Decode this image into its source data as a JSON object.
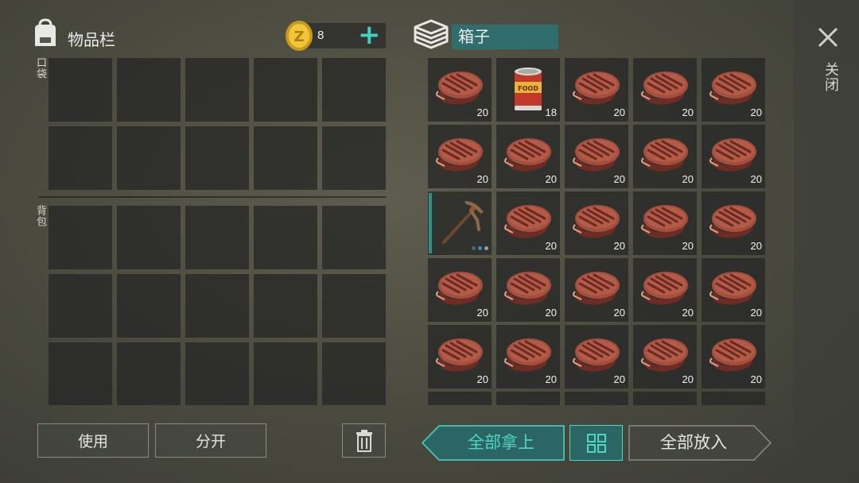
{
  "inventory": {
    "title": "物品栏",
    "pocket_label": "口袋",
    "backpack_label": "背包",
    "coins": "8",
    "add_symbol": "+"
  },
  "chest": {
    "title": "箱子",
    "items": [
      {
        "kind": "steak",
        "qty": "20"
      },
      {
        "kind": "can",
        "qty": "18"
      },
      {
        "kind": "steak",
        "qty": "20"
      },
      {
        "kind": "steak",
        "qty": "20"
      },
      {
        "kind": "steak",
        "qty": "20"
      },
      {
        "kind": "steak",
        "qty": "20"
      },
      {
        "kind": "steak",
        "qty": "20"
      },
      {
        "kind": "steak",
        "qty": "20"
      },
      {
        "kind": "steak",
        "qty": "20"
      },
      {
        "kind": "steak",
        "qty": "20"
      },
      {
        "kind": "pickaxe",
        "qty": ""
      },
      {
        "kind": "steak",
        "qty": "20"
      },
      {
        "kind": "steak",
        "qty": "20"
      },
      {
        "kind": "steak",
        "qty": "20"
      },
      {
        "kind": "steak",
        "qty": "20"
      },
      {
        "kind": "steak",
        "qty": "20"
      },
      {
        "kind": "steak",
        "qty": "20"
      },
      {
        "kind": "steak",
        "qty": "20"
      },
      {
        "kind": "steak",
        "qty": "20"
      },
      {
        "kind": "steak",
        "qty": "20"
      },
      {
        "kind": "steak",
        "qty": "20"
      },
      {
        "kind": "steak",
        "qty": "20"
      },
      {
        "kind": "steak",
        "qty": "20"
      },
      {
        "kind": "steak",
        "qty": "20"
      },
      {
        "kind": "steak",
        "qty": "20"
      }
    ]
  },
  "can_label": "FOOD",
  "buttons": {
    "use": "使用",
    "split": "分开",
    "take_all": "全部拿上",
    "put_all": "全部放入"
  },
  "close_label": "关闭",
  "colors": {
    "accent": "#2f6e6c",
    "accent_text": "#4fd6c8",
    "steak": "#9c4a3c"
  }
}
